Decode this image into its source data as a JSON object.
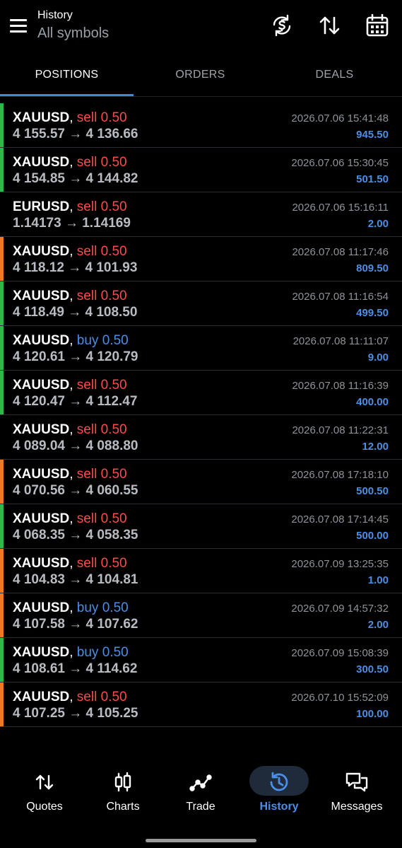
{
  "header": {
    "small_title": "History",
    "big_title": "All symbols",
    "icons": [
      "menu-icon",
      "currency-sync-icon",
      "sort-arrows-icon",
      "calendar-icon"
    ]
  },
  "tabs": [
    {
      "label": "POSITIONS",
      "active": true
    },
    {
      "label": "ORDERS",
      "active": false
    },
    {
      "label": "DEALS",
      "active": false
    }
  ],
  "colors": {
    "sell": "#ff4a4a",
    "buy": "#4a8fe7",
    "profit": "#4a8fe7",
    "accent": "#3f86e0",
    "bar_green": "#2eb84a",
    "bar_orange": "#f07a24"
  },
  "positions": [
    {
      "symbol": "XAUUSD",
      "side": "sell",
      "volume": "0.50",
      "prices": "4 155.57 → 4 136.66",
      "time": "2026.07.06 15:41:48",
      "profit": "945.50",
      "bar": "green"
    },
    {
      "symbol": "XAUUSD",
      "side": "sell",
      "volume": "0.50",
      "prices": "4 154.85 → 4 144.82",
      "time": "2026.07.06 15:30:45",
      "profit": "501.50",
      "bar": "green"
    },
    {
      "symbol": "EURUSD",
      "side": "sell",
      "volume": "0.50",
      "prices": "1.14173 → 1.14169",
      "time": "2026.07.06 15:16:11",
      "profit": "2.00",
      "bar": "none"
    },
    {
      "symbol": "XAUUSD",
      "side": "sell",
      "volume": "0.50",
      "prices": "4 118.12 → 4 101.93",
      "time": "2026.07.08 11:17:46",
      "profit": "809.50",
      "bar": "orange"
    },
    {
      "symbol": "XAUUSD",
      "side": "sell",
      "volume": "0.50",
      "prices": "4 118.49 → 4 108.50",
      "time": "2026.07.08 11:16:54",
      "profit": "499.50",
      "bar": "green"
    },
    {
      "symbol": "XAUUSD",
      "side": "buy",
      "volume": "0.50",
      "prices": "4 120.61 → 4 120.79",
      "time": "2026.07.08 11:11:07",
      "profit": "9.00",
      "bar": "green"
    },
    {
      "symbol": "XAUUSD",
      "side": "sell",
      "volume": "0.50",
      "prices": "4 120.47 → 4 112.47",
      "time": "2026.07.08 11:16:39",
      "profit": "400.00",
      "bar": "green"
    },
    {
      "symbol": "XAUUSD",
      "side": "sell",
      "volume": "0.50",
      "prices": "4 089.04 → 4 088.80",
      "time": "2026.07.08 11:22:31",
      "profit": "12.00",
      "bar": "none"
    },
    {
      "symbol": "XAUUSD",
      "side": "sell",
      "volume": "0.50",
      "prices": "4 070.56 → 4 060.55",
      "time": "2026.07.08 17:18:10",
      "profit": "500.50",
      "bar": "orange"
    },
    {
      "symbol": "XAUUSD",
      "side": "sell",
      "volume": "0.50",
      "prices": "4 068.35 → 4 058.35",
      "time": "2026.07.08 17:14:45",
      "profit": "500.00",
      "bar": "green"
    },
    {
      "symbol": "XAUUSD",
      "side": "sell",
      "volume": "0.50",
      "prices": "4 104.83 → 4 104.81",
      "time": "2026.07.09 13:25:35",
      "profit": "1.00",
      "bar": "orange"
    },
    {
      "symbol": "XAUUSD",
      "side": "buy",
      "volume": "0.50",
      "prices": "4 107.58 → 4 107.62",
      "time": "2026.07.09 14:57:32",
      "profit": "2.00",
      "bar": "orange"
    },
    {
      "symbol": "XAUUSD",
      "side": "buy",
      "volume": "0.50",
      "prices": "4 108.61 → 4 114.62",
      "time": "2026.07.09 15:08:39",
      "profit": "300.50",
      "bar": "green"
    },
    {
      "symbol": "XAUUSD",
      "side": "sell",
      "volume": "0.50",
      "prices": "4 107.25 → 4 105.25",
      "time": "2026.07.10 15:52:09",
      "profit": "100.00",
      "bar": "orange"
    }
  ],
  "nav": [
    {
      "label": "Quotes",
      "icon": "quotes-icon",
      "active": false
    },
    {
      "label": "Charts",
      "icon": "charts-icon",
      "active": false
    },
    {
      "label": "Trade",
      "icon": "trade-icon",
      "active": false
    },
    {
      "label": "History",
      "icon": "history-icon",
      "active": true
    },
    {
      "label": "Messages",
      "icon": "messages-icon",
      "active": false
    }
  ]
}
